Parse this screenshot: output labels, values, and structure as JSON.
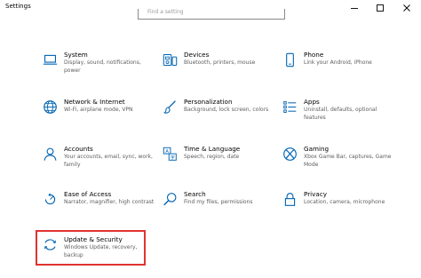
{
  "window": {
    "title": "Settings"
  },
  "search": {
    "placeholder": "Find a setting"
  },
  "tiles": [
    {
      "name": "System",
      "desc": "Display, sound, notifications, power",
      "icon": "laptop-icon"
    },
    {
      "name": "Devices",
      "desc": "Bluetooth, printers, mouse",
      "icon": "keyboard-speaker-icon"
    },
    {
      "name": "Phone",
      "desc": "Link your Android, iPhone",
      "icon": "phone-icon"
    },
    {
      "name": "Network & Internet",
      "desc": "Wi-Fi, airplane mode, VPN",
      "icon": "globe-icon"
    },
    {
      "name": "Personalization",
      "desc": "Background, lock screen, colors",
      "icon": "paintbrush-icon"
    },
    {
      "name": "Apps",
      "desc": "Uninstall, defaults, optional features",
      "icon": "apps-list-icon"
    },
    {
      "name": "Accounts",
      "desc": "Your accounts, email, sync, work, family",
      "icon": "person-icon"
    },
    {
      "name": "Time & Language",
      "desc": "Speech, region, date",
      "icon": "time-language-icon"
    },
    {
      "name": "Gaming",
      "desc": "Xbox Game Bar, captures, Game Mode",
      "icon": "xbox-icon"
    },
    {
      "name": "Ease of Access",
      "desc": "Narrator, magnifier, high contrast",
      "icon": "ease-of-access-icon"
    },
    {
      "name": "Search",
      "desc": "Find my files, permissions",
      "icon": "search-icon"
    },
    {
      "name": "Privacy",
      "desc": "Location, camera, microphone",
      "icon": "lock-icon"
    },
    {
      "name": "Update & Security",
      "desc": "Windows Update, recovery, backup",
      "icon": "sync-icon"
    }
  ],
  "colors": {
    "accent": "#0063b1",
    "highlight": "#e0322f"
  }
}
